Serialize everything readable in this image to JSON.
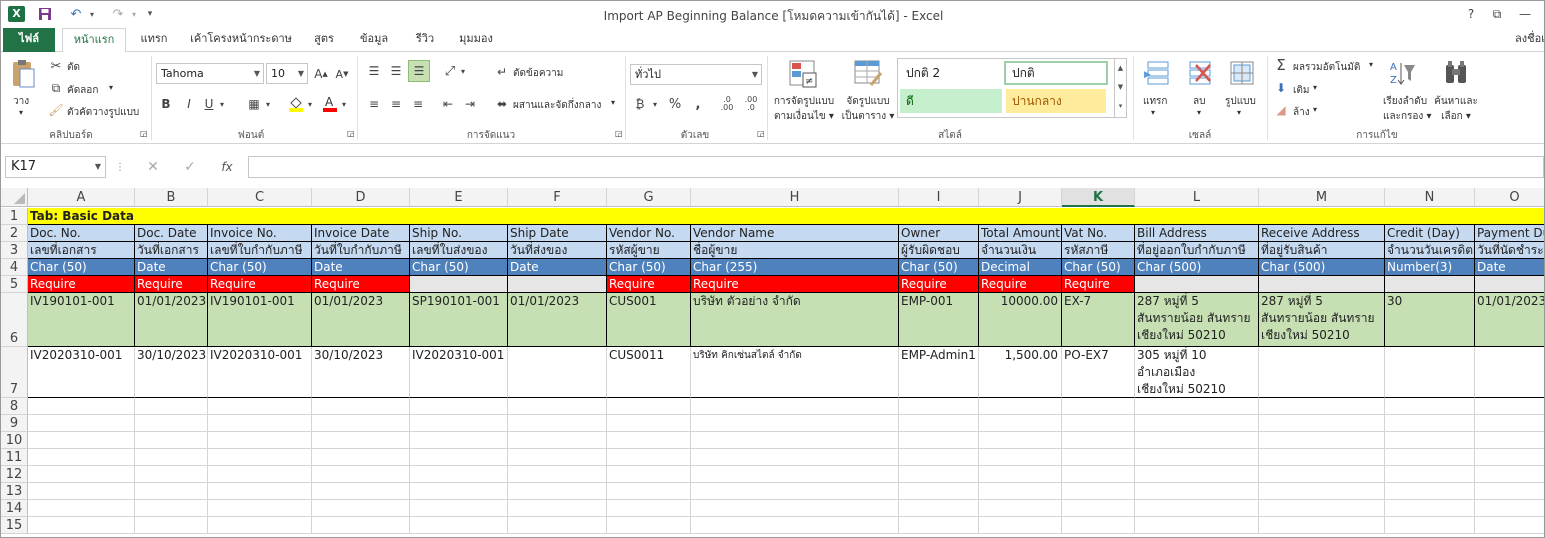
{
  "title": "Import AP Beginning Balance  [โหมดความเข้ากันได้] - Excel",
  "window_buttons": {
    "help": "?",
    "restore": "⧉",
    "minimize": "—"
  },
  "signin": "ลงชื่อเ",
  "tabs": [
    "ไฟล์",
    "หน้าแรก",
    "แทรก",
    "เค้าโครงหน้ากระดาษ",
    "สูตร",
    "ข้อมูล",
    "รีวิว",
    "มุมมอง"
  ],
  "active_tab": "หน้าแรก",
  "ribbon": {
    "clipboard": {
      "paste": "วาง",
      "cut": "ตัด",
      "copy": "คัดลอก",
      "format_painter": "ตัวคัดวางรูปแบบ",
      "label": "คลิปบอร์ด"
    },
    "font": {
      "name": "Tahoma",
      "size": "10",
      "label": "ฟอนต์"
    },
    "alignment": {
      "wrap": "ตัดข้อความ",
      "merge": "ผสานและจัดกึ่งกลาง",
      "label": "การจัดแนว"
    },
    "number": {
      "format": "ทั่วไป",
      "label": "ตัวเลข"
    },
    "styles": {
      "cond_format": [
        "การจัดรูปแบบ",
        "ตามเงื่อนไข"
      ],
      "format_table": [
        "จัดรูปแบบ",
        "เป็นตาราง"
      ],
      "cells": [
        "ปกติ 2",
        "ปกติ",
        "ดี",
        "ปานกลาง"
      ],
      "label": "สไตล์"
    },
    "cells": {
      "insert": "แทรก",
      "delete": "ลบ",
      "format": "รูปแบบ",
      "label": "เซลล์"
    },
    "editing": {
      "autosum": "ผลรวมอัตโนมัติ",
      "fill": "เติม",
      "clear": "ล้าง",
      "sort": [
        "เรียงลำดับ",
        "และกรอง"
      ],
      "find": [
        "ค้นหาและ",
        "เลือก"
      ],
      "label": "การแก้ไข"
    }
  },
  "namebox": "K17",
  "columns": [
    "A",
    "B",
    "C",
    "D",
    "E",
    "F",
    "G",
    "H",
    "I",
    "J",
    "K",
    "L",
    "M",
    "N",
    "O"
  ],
  "selected_column": "K",
  "rows": [
    "1",
    "2",
    "3",
    "4",
    "5",
    "6",
    "7",
    "8",
    "9",
    "10",
    "11",
    "12",
    "13",
    "14",
    "15"
  ],
  "sheet": {
    "tab_title": "Tab: Basic Data",
    "headers_en": [
      "Doc. No.",
      "Doc. Date",
      "Invoice No.",
      "Invoice Date",
      "Ship No.",
      "Ship Date",
      "Vendor No.",
      "Vendor Name",
      "Owner",
      "Total Amount",
      "Vat No.",
      "Bill Address",
      "Receive Address",
      "Credit (Day)",
      "Payment Du"
    ],
    "headers_th": [
      "เลขที่เอกสาร",
      "วันที่เอกสาร",
      "เลขที่ใบกำกับภาษี",
      "วันที่ใบกำกับภาษี",
      "เลขที่ใบส่งของ",
      "วันที่ส่งของ",
      "รหัสผู้ขาย",
      "ชื่อผู้ขาย",
      "ผู้รับผิดชอบ",
      "จำนวนเงิน",
      "รหัสภาษี",
      "ที่อยู่ออกใบกำกับภาษี",
      "ที่อยู่รับสินค้า",
      "จำนวนวันเครดิต",
      "วันที่นัดชำระ"
    ],
    "types": [
      "Char (50)",
      "Date",
      "Char (50)",
      "Date",
      "Char (50)",
      "Date",
      "Char (50)",
      "Char (255)",
      "Char (50)",
      "Decimal",
      "Char (50)",
      "Char (500)",
      "Char (500)",
      "Number(3)",
      "Date"
    ],
    "required": [
      "Require",
      "Require",
      "Require",
      "Require",
      "",
      "",
      "Require",
      "Require",
      "Require",
      "Require",
      "Require",
      "",
      "",
      "",
      ""
    ],
    "row6": [
      "IV190101-001",
      "01/01/2023",
      "IV190101-001",
      "01/01/2023",
      "SP190101-001",
      "01/01/2023",
      "CUS001",
      "บริษัท ตัวอย่าง จำกัด",
      "EMP-001",
      "10000.00",
      "EX-7",
      "287 หมู่ที่ 5\nสันทรายน้อย สันทราย\nเชียงใหม่ 50210",
      "287 หมู่ที่ 5\nสันทรายน้อย สันทราย\nเชียงใหม่ 50210",
      "30",
      "01/01/2023"
    ],
    "row7": [
      "IV2020310-001",
      "30/10/2023",
      "IV2020310-001",
      "30/10/2023",
      "IV2020310-001",
      "",
      "CUS0011",
      "บริษัท คิกเซ่นสไตล์ จำกัด",
      "EMP-Admin1",
      "1,500.00",
      "PO-EX7",
      "305 หมู่ที่ 10\nอำเภอเมือง\nเชียงใหม่ 50210",
      "",
      "",
      ""
    ]
  },
  "colors": {
    "excel_green": "#217346",
    "yellow": "#ffff00",
    "light_blue": "#c5d9f1",
    "blue": "#4f81bd",
    "red": "#ff0000",
    "green_fill": "#c6e0b4",
    "gray": "#e7e6e6"
  }
}
